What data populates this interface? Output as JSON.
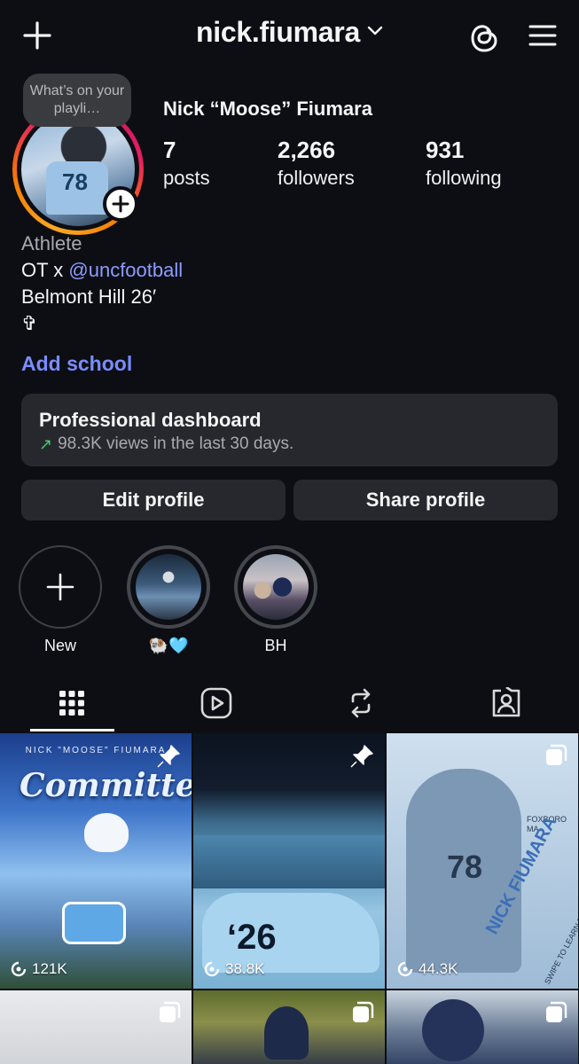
{
  "header": {
    "username": "nick.fiumara",
    "icons": [
      "plus-icon",
      "chevron-down-icon",
      "threads-icon",
      "menu-icon"
    ]
  },
  "profile": {
    "note": "What’s on your playli…",
    "display_name": "Nick “Moose” Fiumara",
    "stats": [
      {
        "value": "7",
        "label": "posts"
      },
      {
        "value": "2,266",
        "label": "followers"
      },
      {
        "value": "931",
        "label": "following"
      }
    ],
    "category": "Athlete",
    "bio_prefix": "OT x ",
    "bio_mention": "@uncfootball",
    "bio_line2": "Belmont Hill 26′",
    "bio_line3": "✞",
    "add_school": "Add school"
  },
  "dashboard": {
    "title": "Professional dashboard",
    "arrow": "↗",
    "subtitle": "98.3K views in the last 30 days."
  },
  "actions": {
    "edit": "Edit profile",
    "share": "Share profile"
  },
  "highlights": [
    {
      "label": "New"
    },
    {
      "label": "🐏🩵"
    },
    {
      "label": "BH"
    }
  ],
  "tabs": [
    "grid-icon",
    "reels-icon",
    "reposts-icon",
    "tagged-icon"
  ],
  "posts": [
    {
      "views": "121K",
      "pinned": true,
      "overlay": "Committed",
      "top_text": "NICK \"MOOSE\" FIUMARA"
    },
    {
      "views": "38.8K",
      "pinned": true,
      "overlay": "‘26"
    },
    {
      "views": "44.3K",
      "pinned": false,
      "overlay": "78",
      "side_text": "NICK FIUMARA",
      "small_text": "SWIPE TO LEARN MORE",
      "place": "FOXBORO MA"
    },
    {
      "views": "",
      "pinned": false
    },
    {
      "views": "",
      "pinned": false
    },
    {
      "views": "",
      "pinned": false
    }
  ],
  "colors": {
    "background": "#0c0e13",
    "card": "#26282d",
    "link": "#7a8cff",
    "trend": "#49c96e"
  }
}
